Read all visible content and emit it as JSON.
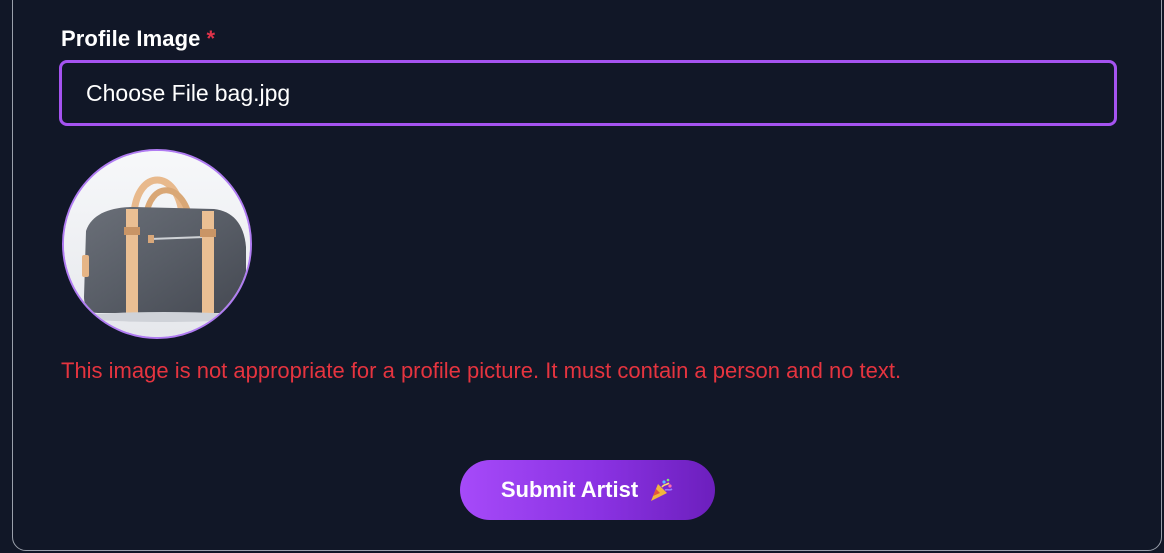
{
  "form": {
    "profile_label": "Profile Image",
    "required_mark": "*",
    "file_button_label": "Choose File",
    "file_name": "bag.jpg",
    "preview_image": "bag-photo",
    "error_message": "This image is not appropriate for a profile picture. It must contain a person and no text.",
    "submit_label": "Submit Artist",
    "submit_icon": "party-popper-icon"
  },
  "colors": {
    "background": "#111727",
    "accent": "#a553f0",
    "error": "#e5343f",
    "required": "#e0334a"
  }
}
